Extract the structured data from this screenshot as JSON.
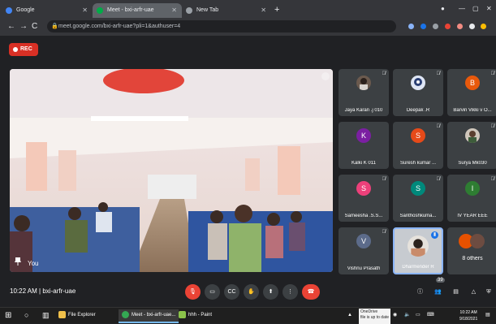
{
  "browser": {
    "tabs": [
      {
        "title": "Google",
        "active": false
      },
      {
        "title": "Meet - bxi-arfr-uae",
        "active": true
      },
      {
        "title": "New Tab",
        "active": false
      }
    ],
    "url": "meet.google.com/bxi-arfr-uae?pli=1&authuser=4"
  },
  "meet": {
    "rec_label": "REC",
    "main_label": "You",
    "time": "10:22 AM",
    "separator": "|",
    "meeting_code": "bxi-arfr-uae",
    "participant_badge": "39",
    "participants": [
      {
        "name": "Jaya Karan .j 010",
        "initial": "",
        "color": "#8d6e63",
        "photo": true
      },
      {
        "name": "Deepak .R",
        "initial": "",
        "color": "#5c6bc0",
        "photo": true
      },
      {
        "name": "Barvin Vikki v O...",
        "initial": "B",
        "color": "#e8590c"
      },
      {
        "name": "Kalki K 011",
        "initial": "K",
        "color": "#7b1fa2"
      },
      {
        "name": "Suresh kumar ...",
        "initial": "S",
        "color": "#e64a19"
      },
      {
        "name": "Surya Mk030",
        "initial": "",
        "color": "#6d4c41",
        "photo": true
      },
      {
        "name": "Sameesha .S.S...",
        "initial": "S",
        "color": "#ec407a"
      },
      {
        "name": "Santhoshkuma...",
        "initial": "S",
        "color": "#00897b"
      },
      {
        "name": "IV YEAR EEE",
        "initial": "I",
        "color": "#2e7d32"
      },
      {
        "name": "Vishnu Prasath",
        "initial": "V",
        "color": "#5c6b8a"
      },
      {
        "name": "Dharmender R",
        "initial": "",
        "color": "#9e9e9e",
        "photo": true
      },
      {
        "name": "8 others",
        "initial": "",
        "color": "#e65100"
      }
    ]
  },
  "taskbar": {
    "items": [
      "File Explorer",
      "Meet - bxi-arfr-uae...",
      "hhh - Paint"
    ],
    "notification": "OneDrive\nfile is up to date",
    "clock_time": "10:22 AM",
    "clock_date": "9/18/2021"
  }
}
